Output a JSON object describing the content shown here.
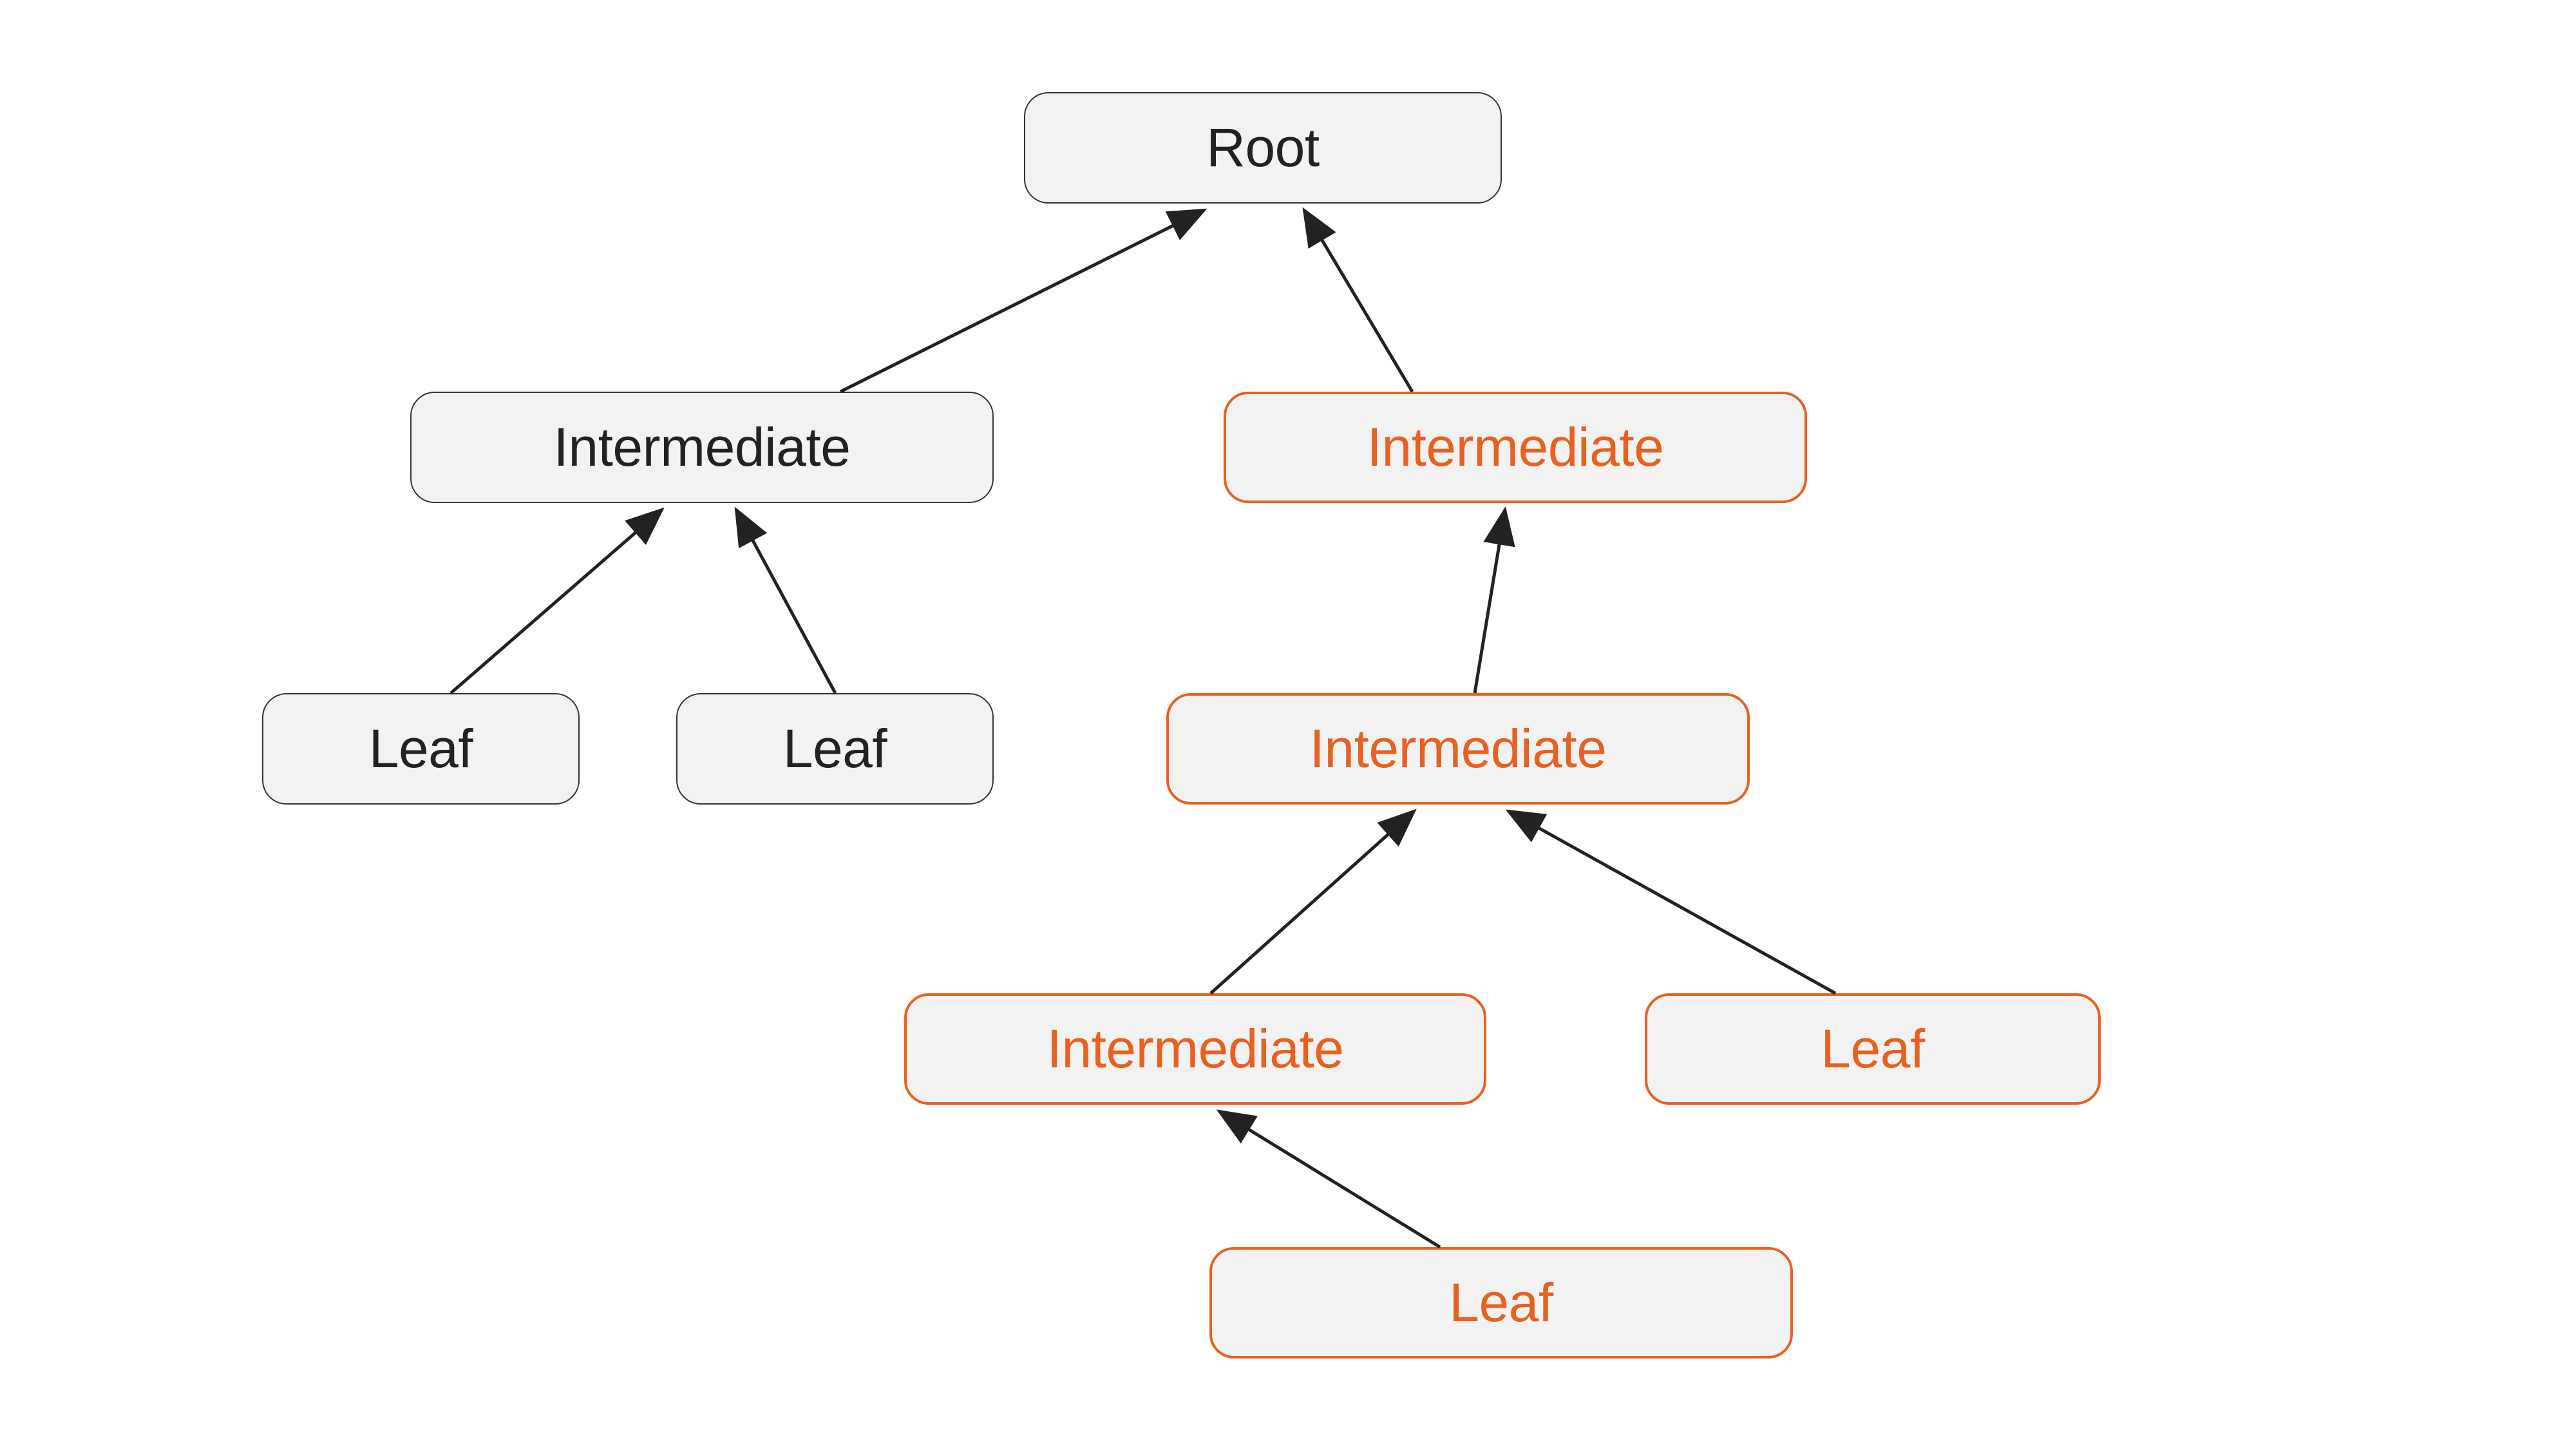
{
  "nodes": {
    "root": {
      "label": "Root"
    },
    "intermediate_left": {
      "label": "Intermediate"
    },
    "intermediate_right": {
      "label": "Intermediate"
    },
    "leaf_left_1": {
      "label": "Leaf"
    },
    "leaf_left_2": {
      "label": "Leaf"
    },
    "intermediate_mid": {
      "label": "Intermediate"
    },
    "intermediate_lower": {
      "label": "Intermediate"
    },
    "leaf_right": {
      "label": "Leaf"
    },
    "leaf_bottom": {
      "label": "Leaf"
    }
  },
  "colors": {
    "orange": "#e8611f",
    "black": "#333333",
    "node_bg": "#f2f2f2"
  }
}
